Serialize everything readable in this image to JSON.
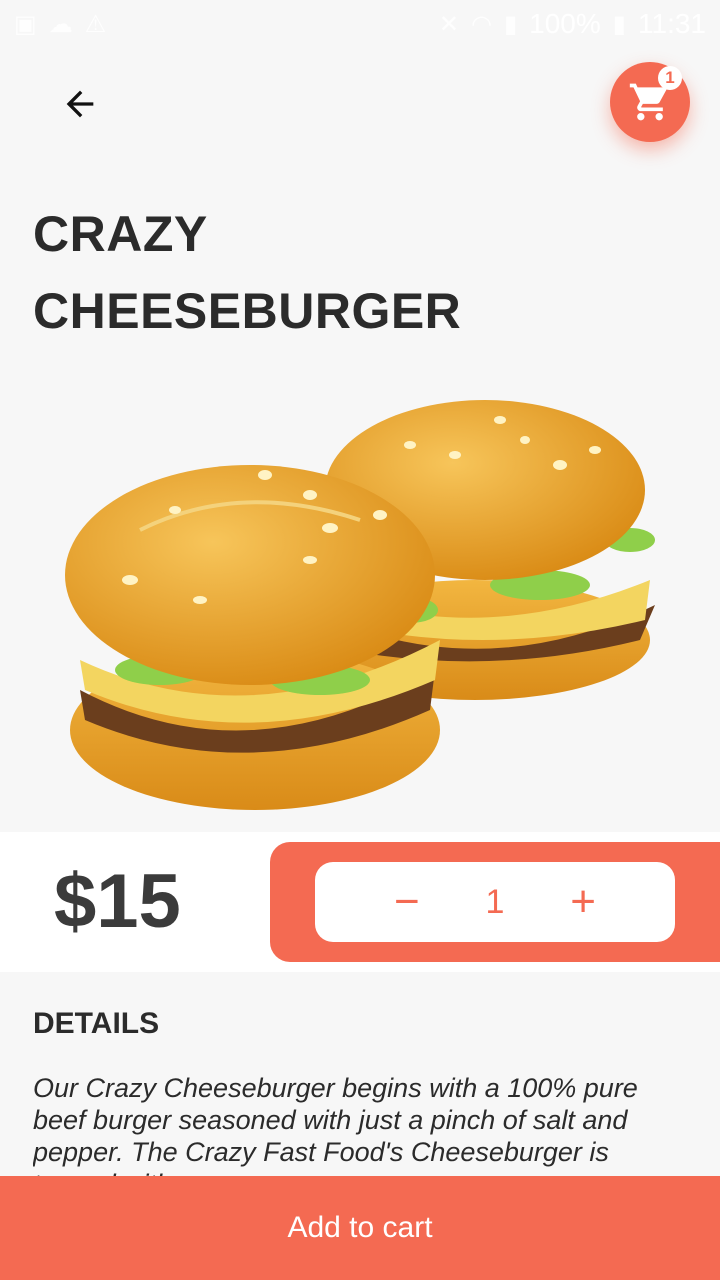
{
  "status_bar": {
    "battery": "100%",
    "time": "11:31"
  },
  "header": {
    "cart_count": "1"
  },
  "product": {
    "title_line1": "CRAZY",
    "title_line2": "CHEESEBURGER",
    "price": "$15",
    "quantity": "1",
    "minus_label": "−",
    "plus_label": "+"
  },
  "details": {
    "heading": "DETAILS",
    "text": "Our Crazy Cheeseburger begins with a 100% pure beef burger seasoned with just a pinch of salt and pepper. The Crazy Fast Food's Cheeseburger is topped with a"
  },
  "footer": {
    "add_to_cart_label": "Add to cart"
  },
  "colors": {
    "accent": "#f46a52",
    "background": "#f7f7f7",
    "text_dark": "#2b2b2b"
  },
  "icons": {
    "back": "arrow-left-icon",
    "cart": "shopping-cart-icon"
  }
}
